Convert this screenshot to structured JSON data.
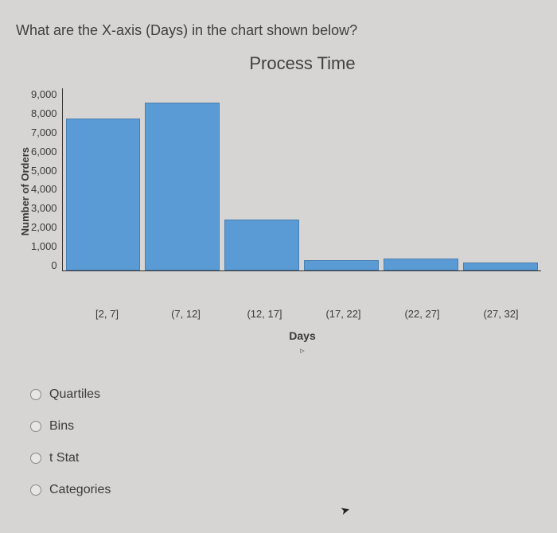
{
  "question": "What are the X-axis (Days) in the chart shown below?",
  "chart_data": {
    "type": "bar",
    "title": "Process Time",
    "xlabel": "Days",
    "ylabel": "Number of Orders",
    "ylim": [
      0,
      9000
    ],
    "yticks": [
      "9,000",
      "8,000",
      "7,000",
      "6,000",
      "5,000",
      "4,000",
      "3,000",
      "2,000",
      "1,000",
      "0"
    ],
    "categories": [
      "[2, 7]",
      "(7, 12]",
      "(12, 17]",
      "(17, 22]",
      "(22, 27]",
      "(27, 32]"
    ],
    "values": [
      7500,
      8300,
      2500,
      500,
      600,
      400
    ]
  },
  "options": [
    {
      "label": "Quartiles"
    },
    {
      "label": "Bins"
    },
    {
      "label": "t Stat"
    },
    {
      "label": "Categories"
    }
  ]
}
